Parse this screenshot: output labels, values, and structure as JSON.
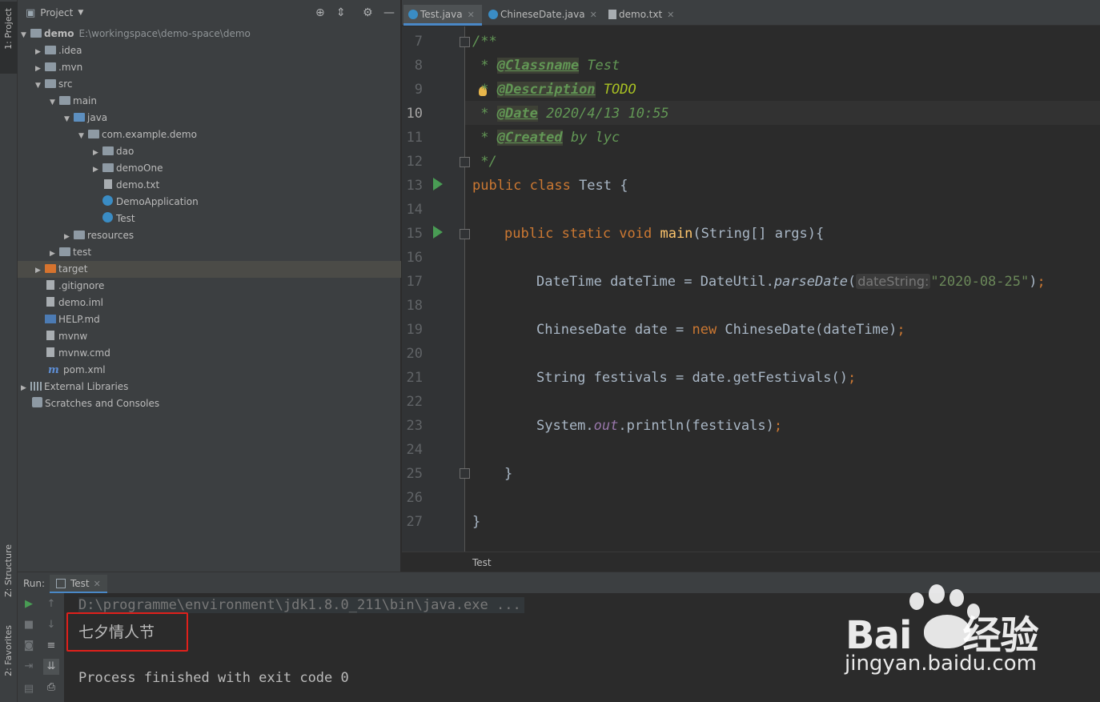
{
  "sidebar_tabs": {
    "project": "1: Project",
    "structure": "Z: Structure",
    "favorites": "2: Favorites"
  },
  "project_panel": {
    "title": "Project",
    "tree": [
      {
        "label": "demo",
        "path": "E:\\workingspace\\demo-space\\demo",
        "expanded": true,
        "icon": "module-folder-icon"
      },
      {
        "label": ".idea",
        "expanded": false,
        "icon": "folder-icon"
      },
      {
        "label": ".mvn",
        "expanded": false,
        "icon": "folder-icon"
      },
      {
        "label": "src",
        "expanded": true,
        "icon": "folder-icon"
      },
      {
        "label": "main",
        "expanded": true,
        "icon": "folder-icon"
      },
      {
        "label": "java",
        "expanded": true,
        "icon": "source-folder-icon"
      },
      {
        "label": "com.example.demo",
        "expanded": true,
        "icon": "package-icon"
      },
      {
        "label": "dao",
        "expanded": false,
        "icon": "package-icon"
      },
      {
        "label": "demoOne",
        "expanded": false,
        "icon": "package-icon"
      },
      {
        "label": "demo.txt",
        "icon": "text-file-icon"
      },
      {
        "label": "DemoApplication",
        "icon": "spring-class-icon"
      },
      {
        "label": "Test",
        "icon": "class-icon"
      },
      {
        "label": "resources",
        "expanded": false,
        "icon": "resources-folder-icon"
      },
      {
        "label": "test",
        "expanded": false,
        "icon": "folder-icon"
      },
      {
        "label": "target",
        "expanded": false,
        "icon": "excluded-folder-icon",
        "selected": true
      },
      {
        "label": ".gitignore",
        "icon": "text-file-icon"
      },
      {
        "label": "demo.iml",
        "icon": "iml-file-icon"
      },
      {
        "label": "HELP.md",
        "icon": "markdown-file-icon"
      },
      {
        "label": "mvnw",
        "icon": "text-file-icon"
      },
      {
        "label": "mvnw.cmd",
        "icon": "text-file-icon"
      },
      {
        "label": "pom.xml",
        "icon": "maven-icon"
      },
      {
        "label": "External Libraries",
        "expanded": false,
        "icon": "libraries-icon"
      },
      {
        "label": "Scratches and Consoles",
        "icon": "scratches-icon"
      }
    ]
  },
  "editor": {
    "tabs": [
      {
        "label": "Test.java",
        "active": true
      },
      {
        "label": "ChineseDate.java",
        "active": false
      },
      {
        "label": "demo.txt",
        "active": false
      }
    ],
    "line_numbers": [
      "7",
      "8",
      "9",
      "10",
      "11",
      "12",
      "13",
      "14",
      "15",
      "16",
      "17",
      "18",
      "19",
      "20",
      "21",
      "22",
      "23",
      "24",
      "25",
      "26",
      "27"
    ],
    "current_line": "10",
    "code": {
      "l7": "/**",
      "l8_star": " * ",
      "l8_tag": "@Classname",
      "l8_rest": " Test",
      "l9_star": " * ",
      "l9_tag": "@Description",
      "l9_rest": " TODO",
      "l10_star": " * ",
      "l10_tag": "@Date",
      "l10_rest": " 2020/4/13 10:55",
      "l11_star": " * ",
      "l11_tag": "@Created",
      "l11_rest": " by lyc",
      "l12": " */",
      "l13_kw": "public class",
      "l13_rest": " Test {",
      "l15_kw": "public static void",
      "l15_fn": " main",
      "l15_rest": "(String[] args){",
      "l17_a": "DateTime dateTime = DateUtil.",
      "l17_m": "parseDate",
      "l17_p": "(",
      "l17_hint": "dateString:",
      "l17_str": "\"2020-08-25\"",
      "l17_end": ")",
      "l17_semi": ";",
      "l19_a": "ChineseDate date = ",
      "l19_kw": "new",
      "l19_b": " ChineseDate(dateTime)",
      "l19_semi": ";",
      "l21_a": "String festivals = date.getFestivals()",
      "l21_semi": ";",
      "l23_a": "System.",
      "l23_f": "out",
      "l23_b": ".println(festivals)",
      "l23_semi": ";",
      "l25": "}",
      "l27": "}"
    },
    "breadcrumb": "Test"
  },
  "run_panel": {
    "label": "Run:",
    "tab": "Test",
    "command": "D:\\programme\\environment\\jdk1.8.0_211\\bin\\java.exe ...",
    "output": "七夕情人节",
    "exit": "Process finished with exit code 0"
  },
  "watermark": {
    "brand_left": "Bai",
    "brand_right": "经验",
    "url": "jingyan.baidu.com"
  },
  "colors": {
    "accent": "#4a88c7",
    "highlight_box": "#e0201b",
    "run_green": "#499c54"
  }
}
